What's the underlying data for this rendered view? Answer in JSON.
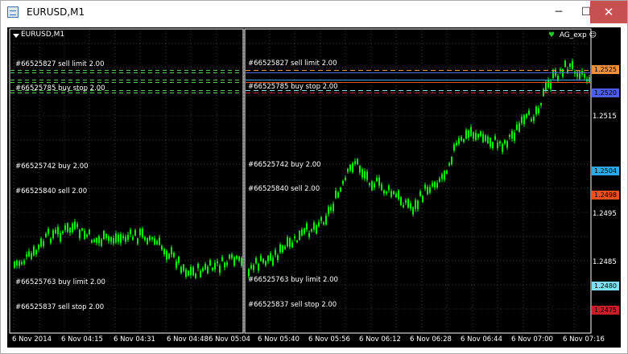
{
  "window": {
    "title": "EURUSD,M1",
    "min_glyph": "─",
    "max_glyph": "☐",
    "close_glyph": "✕"
  },
  "chart": {
    "symbol": "EURUSD,M1",
    "ea_name": "AG_exp",
    "ea_face": "☺",
    "heart": "♥",
    "colors": {
      "background": "#000000",
      "candle": "#00ff00",
      "grid": "#3a3a3a"
    },
    "orders": [
      {
        "label": "#66525827 sell limit 2.00",
        "price": "1.2525",
        "price_value": 1.2525,
        "color": "#f0903a",
        "label_color": "#f0903a",
        "left_color": "#55c655"
      },
      {
        "label": "#66525785 buy stop 2.00",
        "price": "1.2520",
        "price_value": 1.252,
        "color": "#4c5de8",
        "label_color": "#4c5de8",
        "left_color": "#55c655"
      },
      {
        "label": "#66525742 buy 2.00",
        "price": "1.2504",
        "price_value": 1.2504,
        "color": "#2fa8e8",
        "label_color": "#2fa8e8",
        "left_color": "#55c655"
      },
      {
        "label": "#66525840 sell 2.00",
        "price": "1.2498",
        "price_value": 1.2498,
        "color": "#e85020",
        "label_color": "#e85020",
        "left_color": "#55c655"
      },
      {
        "label": "#66525763 buy limit 2.00",
        "price": "1.2480",
        "price_value": 1.248,
        "color": "#80e0f0",
        "label_color": "#80e0f0",
        "left_color": "#55c655"
      },
      {
        "label": "#66525837 sell stop 2.00",
        "price": "1.2475",
        "price_value": 1.2475,
        "color": "#c81e28",
        "label_color": "#c81e28",
        "left_color": "#55c655"
      }
    ],
    "price_axis": [
      "1.2515",
      "1.2495",
      "1.2485"
    ],
    "time_axis": [
      "6 Nov 2014",
      "6 Nov 04:15",
      "6 Nov 04:31",
      "6 Nov 04:48",
      "6 Nov 05:04",
      "6 Nov 05:40",
      "6 Nov 05:56",
      "6 Nov 06:12",
      "6 Nov 06:28",
      "6 Nov 06:44",
      "6 Nov 07:00",
      "6 Nov 07:16"
    ]
  }
}
